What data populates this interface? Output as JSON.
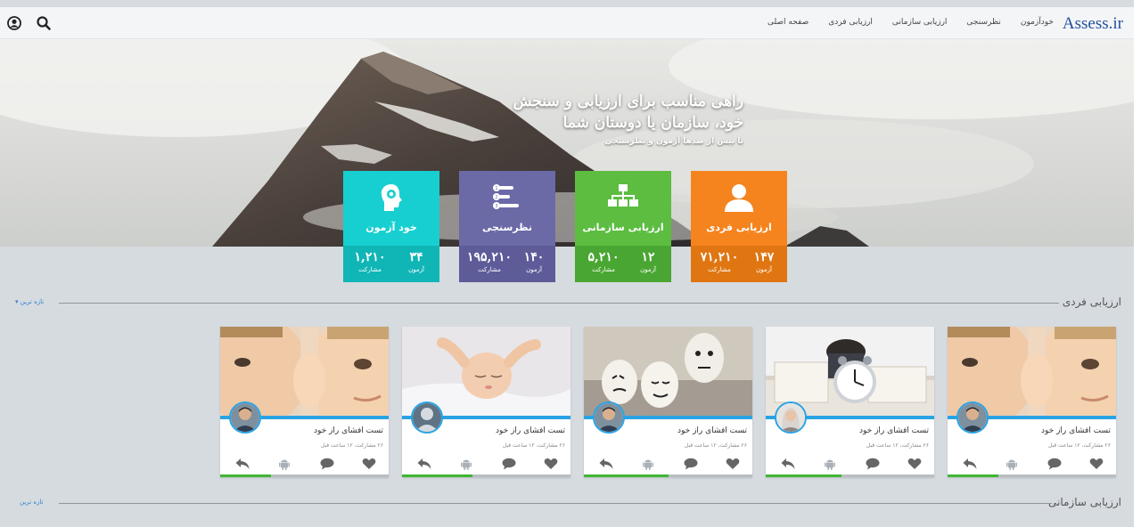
{
  "brand": {
    "logo_text": "Assess.ir"
  },
  "nav": [
    {
      "label": "صفحه اصلی"
    },
    {
      "label": "ارزیابی فردی"
    },
    {
      "label": "ارزیابی سازمانی"
    },
    {
      "label": "نظرسنجی"
    },
    {
      "label": "خودآزمون"
    }
  ],
  "hero": {
    "title_line1": "راهی مناسب برای ارزیابی و سنجش",
    "title_line2": "خود، سازمان یا دوستان شما",
    "subtitle": "با بیش از صدها آزمون و نظرسنجی"
  },
  "tiles": [
    {
      "name": "ارزیابی فردی",
      "icon": "person-icon",
      "color": "#f5841f",
      "dark": "#e07612",
      "tests_value": "۱۴۷",
      "tests_label": "آزمون",
      "participants_value": "۷۱,۲۱۰",
      "participants_label": "مشارکت"
    },
    {
      "name": "ارزیابی سازمانی",
      "icon": "org-chart-icon",
      "color": "#5cbd41",
      "dark": "#4aa632",
      "tests_value": "۱۲",
      "tests_label": "آزمون",
      "participants_value": "۵,۲۱۰",
      "participants_label": "مشارکت"
    },
    {
      "name": "نظرسنجی",
      "icon": "poll-list-icon",
      "color": "#6b6aa7",
      "dark": "#5d5b98",
      "tests_value": "۱۴۰",
      "tests_label": "آزمون",
      "participants_value": "۱۹۵,۲۱۰",
      "participants_label": "مشارکت"
    },
    {
      "name": "خود آزمون",
      "icon": "head-gear-icon",
      "color": "#17cfd0",
      "dark": "#10b5b6",
      "tests_value": "۳۴",
      "tests_label": "آزمون",
      "participants_value": "۱,۲۱۰",
      "participants_label": "مشارکت"
    }
  ],
  "sections": [
    {
      "title": "ارزیابی فردی",
      "link": "تازه ترین"
    },
    {
      "title": "ارزیابی سازمانی",
      "link": "تازه ترین"
    }
  ],
  "cards": [
    {
      "title": "تست افشای راز خود",
      "meta": "۲۶ مشارکت، ۱۲ ساعت قبل",
      "image": "boy-whisper",
      "avatar": "man-avatar",
      "progress": 0.3
    },
    {
      "title": "تست افشای راز خود",
      "meta": "۲۶ مشارکت، ۱۲ ساعت قبل",
      "image": "man-clock-papers",
      "avatar": "woman-avatar",
      "progress": 0.45
    },
    {
      "title": "تست افشای راز خود",
      "meta": "۲۶ مشارکت، ۱۲ ساعت قبل",
      "image": "eggs-faces",
      "avatar": "man-avatar",
      "progress": 0.5
    },
    {
      "title": "تست افشای راز خود",
      "meta": "۲۶ مشارکت، ۱۲ ساعت قبل",
      "image": "sleeping-baby",
      "avatar": "placeholder-avatar",
      "progress": 0.42
    },
    {
      "title": "تست افشای راز خود",
      "meta": "۲۶ مشارکت، ۱۲ ساعت قبل",
      "image": "boy-whisper",
      "avatar": "man-avatar",
      "progress": 0.3
    }
  ],
  "colors": {
    "accent": "#2aa3e3",
    "progress": "#3fb533",
    "link": "#2f7fd1"
  }
}
